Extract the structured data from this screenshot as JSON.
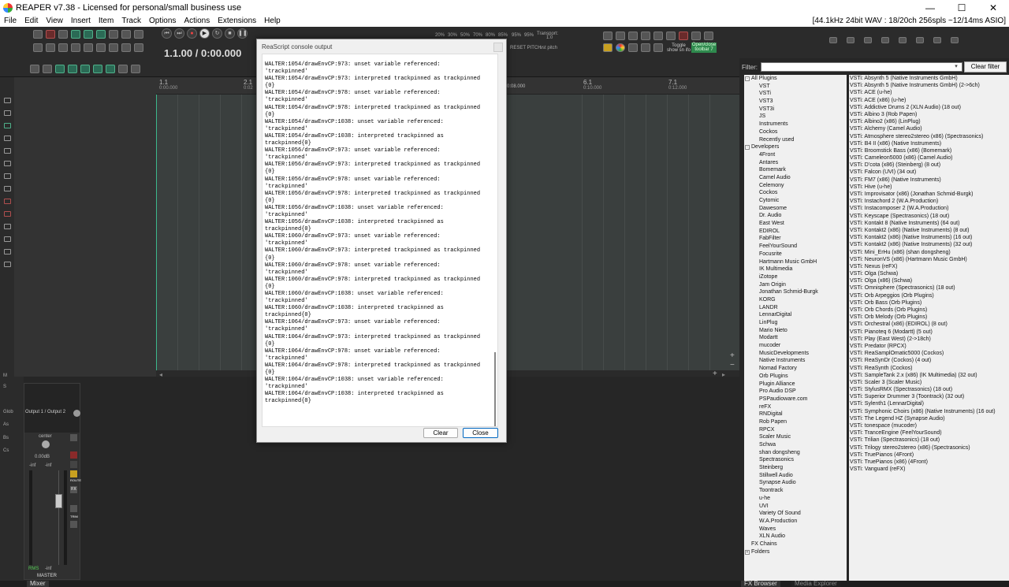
{
  "window": {
    "title": "REAPER v7.38 - Licensed for personal/small business use",
    "min": "—",
    "max": "☐",
    "close": "✕"
  },
  "menu": {
    "items": [
      "File",
      "Edit",
      "View",
      "Insert",
      "Item",
      "Track",
      "Options",
      "Actions",
      "Extensions",
      "Help"
    ],
    "status": "[44.1kHz 24bit WAV : 18/20ch 256spls ~12/14ms ASIO]"
  },
  "transport": {
    "timecode": "1.1.00 / 0:00.000",
    "playrate_ticks": [
      "20%",
      "30%",
      "50%",
      "70%",
      "80%",
      "85%",
      "95%",
      "95%"
    ],
    "playrate_label": "Transport:",
    "playrate_value": "1.0",
    "reset": "RESET PITCH",
    "vst": "vst pitch",
    "toggle": "Toggle show sn ifo",
    "openclose": "Open/close toolbar 7"
  },
  "ruler": {
    "marks": [
      {
        "bar": "1.1",
        "time": "0:00.000"
      },
      {
        "bar": "2.1",
        "time": "0:02"
      },
      {
        "bar": "6.1",
        "time": "0:10.000"
      },
      {
        "bar": "7.1",
        "time": "0:12.000"
      }
    ],
    "hidden_time": "0:08.000"
  },
  "leftbar": {
    "labels": [
      "M",
      "S",
      "Glob",
      "As",
      "Bs",
      "Cs"
    ]
  },
  "mixer": {
    "route": "Output 1 / Output 2",
    "pan": "center",
    "volume": "0.00dB",
    "peak_l": "-inf",
    "peak_r": "-inf",
    "rms": "RMS",
    "rms_val": "-inf",
    "name": "MASTER",
    "route_btn": "ROUTE",
    "fx_btn": "FX",
    "trim_btn": "TRIM"
  },
  "tabs": {
    "mixer": "Mixer",
    "fx_browser": "FX Browser",
    "media_explorer": "Media Explorer"
  },
  "fx": {
    "filter_label": "Filter:",
    "clear_filter": "Clear filter",
    "tree": [
      {
        "label": "All Plugins",
        "level": 0,
        "exp": "-"
      },
      {
        "label": "VST",
        "level": 1
      },
      {
        "label": "VSTi",
        "level": 1
      },
      {
        "label": "VST3",
        "level": 1
      },
      {
        "label": "VST3i",
        "level": 1
      },
      {
        "label": "JS",
        "level": 1
      },
      {
        "label": "Instruments",
        "level": 1
      },
      {
        "label": "Cockos",
        "level": 1
      },
      {
        "label": "Recently used",
        "level": 1
      },
      {
        "label": "Developers",
        "level": 0,
        "exp": "-"
      },
      {
        "label": "4Front",
        "level": 1
      },
      {
        "label": "Antares",
        "level": 1
      },
      {
        "label": "Bomemark",
        "level": 1
      },
      {
        "label": "Camel Audio",
        "level": 1
      },
      {
        "label": "Celemony",
        "level": 1
      },
      {
        "label": "Cockos",
        "level": 1
      },
      {
        "label": "Cytomic",
        "level": 1
      },
      {
        "label": "Dawesome",
        "level": 1
      },
      {
        "label": "Dr. Audio",
        "level": 1
      },
      {
        "label": "East West",
        "level": 1
      },
      {
        "label": "EDIROL",
        "level": 1
      },
      {
        "label": "FabFilter",
        "level": 1
      },
      {
        "label": "FeelYourSound",
        "level": 1
      },
      {
        "label": "Focusrite",
        "level": 1
      },
      {
        "label": "Hartmann Music GmbH",
        "level": 1
      },
      {
        "label": "IK Multimedia",
        "level": 1
      },
      {
        "label": "iZotope",
        "level": 1
      },
      {
        "label": "Jam Origin",
        "level": 1
      },
      {
        "label": "Jonathan Schmid-Burgk",
        "level": 1
      },
      {
        "label": "KORG",
        "level": 1
      },
      {
        "label": "LANDR",
        "level": 1
      },
      {
        "label": "LennarDigital",
        "level": 1
      },
      {
        "label": "LinPlug",
        "level": 1
      },
      {
        "label": "Mario Nieto",
        "level": 1
      },
      {
        "label": "Modartt",
        "level": 1
      },
      {
        "label": "mucoder",
        "level": 1
      },
      {
        "label": "MusicDevelopments",
        "level": 1
      },
      {
        "label": "Native Instruments",
        "level": 1
      },
      {
        "label": "Nomad Factory",
        "level": 1
      },
      {
        "label": "Orb Plugins",
        "level": 1
      },
      {
        "label": "Plugin Alliance",
        "level": 1
      },
      {
        "label": "Pro Audio DSP",
        "level": 1
      },
      {
        "label": "PSPaudioware.com",
        "level": 1
      },
      {
        "label": "reFX",
        "level": 1
      },
      {
        "label": "RNDigital",
        "level": 1
      },
      {
        "label": "Rob Papen",
        "level": 1
      },
      {
        "label": "RPCX",
        "level": 1
      },
      {
        "label": "Scaler Music",
        "level": 1
      },
      {
        "label": "Schwa",
        "level": 1
      },
      {
        "label": "shan dongsheng",
        "level": 1
      },
      {
        "label": "Spectrasonics",
        "level": 1
      },
      {
        "label": "Steinberg",
        "level": 1
      },
      {
        "label": "Stillwell Audio",
        "level": 1
      },
      {
        "label": "Synapse Audio",
        "level": 1
      },
      {
        "label": "Toontrack",
        "level": 1
      },
      {
        "label": "u-he",
        "level": 1
      },
      {
        "label": "UVI",
        "level": 1
      },
      {
        "label": "Variety Of Sound",
        "level": 1
      },
      {
        "label": "W.A.Production",
        "level": 1
      },
      {
        "label": "Waves",
        "level": 1
      },
      {
        "label": "XLN Audio",
        "level": 1
      },
      {
        "label": "FX Chains",
        "level": 0
      },
      {
        "label": "Folders",
        "level": 0,
        "exp": "+"
      }
    ],
    "plugins": [
      "VSTi: Absynth 5 (Native Instruments GmbH)",
      "VSTi: Absynth 5 (Native Instruments GmbH) (2->6ch)",
      "VSTi: ACE (u-he)",
      "VSTi: ACE (x86) (u-he)",
      "VSTi: Addictive Drums 2 (XLN Audio) (18 out)",
      "VSTi: Albino 3 (Rob Papen)",
      "VSTi: Albino2 (x86) (LinPlug)",
      "VSTi: Alchemy (Camel Audio)",
      "VSTi: Atmosphere stereo2stereo (x86) (Spectrasonics)",
      "VSTi: B4 II (x86) (Native Instruments)",
      "VSTi: Broomstick Bass (x86) (Bomemark)",
      "VSTi: Cameleon5000 (x86) (Camel Audio)",
      "VSTi: D'cota (x86) (Steinberg) (8 out)",
      "VSTi: Falcon (UVI) (34 out)",
      "VSTi: FM7 (x86) (Native Instruments)",
      "VSTi: Hive (u-he)",
      "VSTi: Improvisator (x86) (Jonathan Schmid-Burgk)",
      "VSTi: Instachord 2 (W.A.Production)",
      "VSTi: Instacomposer 2 (W.A.Production)",
      "VSTi: Keyscape (Spectrasonics) (18 out)",
      "VSTi: Kontakt 8 (Native Instruments) (64 out)",
      "VSTi: Kontakt2 (x86) (Native Instruments) (8 out)",
      "VSTi: Kontakt2 (x86) (Native Instruments) (16 out)",
      "VSTi: Kontakt2 (x86) (Native Instruments) (32 out)",
      "VSTi: Mini_ErHu (x86) (shan dongsheng)",
      "VSTi: NeuronVS (x86) (Hartmann Music GmbH)",
      "VSTi: Nexus (reFX)",
      "VSTi: Olga (Schwa)",
      "VSTi: Olga (x86) (Schwa)",
      "VSTi: Omnisphere (Spectrasonics) (18 out)",
      "VSTi: Orb Arpeggios (Orb Plugins)",
      "VSTi: Orb Bass (Orb Plugins)",
      "VSTi: Orb Chords (Orb Plugins)",
      "VSTi: Orb Melody (Orb Plugins)",
      "VSTi: Orchestral (x86) (EDIROL) (8 out)",
      "VSTi: Pianoteq 6 (Modartt) (5 out)",
      "VSTi: Play (East West) (2->18ch)",
      "VSTi: Predator (RPCX)",
      "VSTi: ReaSamplOmatic5000 (Cockos)",
      "VSTi: ReaSynDr (Cockos) (4 out)",
      "VSTi: ReaSynth (Cockos)",
      "VSTi: SampleTank 2.x (x86) (IK Multimedia) (32 out)",
      "VSTi: Scaler 3 (Scaler Music)",
      "VSTi: StylusRMX (Spectrasonics) (18 out)",
      "VSTi: Superior Drummer 3 (Toontrack) (32 out)",
      "VSTi: Sylenth1 (LennarDigital)",
      "VSTi: Symphonic Choirs (x86) (Native Instruments) (16 out)",
      "VSTi: The Legend HZ (Synapse Audio)",
      "VSTi: tonespace (mucoder)",
      "VSTi: TranceEngine (FeelYourSound)",
      "VSTi: Trilian (Spectrasonics) (18 out)",
      "VSTi: Trilogy stereo2stereo (x86) (Spectrasonics)",
      "VSTi: TruePianos (4Front)",
      "VSTi: TruePianos (x86) (4Front)",
      "VSTi: Vanguard (reFX)"
    ]
  },
  "dialog": {
    "title": "ReaScript console output",
    "clear": "Clear",
    "close": "Close",
    "console_text": "WALTER:1054/drawEnvCP:973: unset variable referenced:\n'trackpinned'\nWALTER:1054/drawEnvCP:973: interpreted trackpinned as trackpinned\n{0}\nWALTER:1054/drawEnvCP:978: unset variable referenced:\n'trackpinned'\nWALTER:1054/drawEnvCP:978: interpreted trackpinned as trackpinned\n{0}\nWALTER:1054/drawEnvCP:1038: unset variable referenced:\n'trackpinned'\nWALTER:1054/drawEnvCP:1038: interpreted trackpinned as\ntrackpinned{0}\nWALTER:1056/drawEnvCP:973: unset variable referenced:\n'trackpinned'\nWALTER:1056/drawEnvCP:973: interpreted trackpinned as trackpinned\n{0}\nWALTER:1056/drawEnvCP:978: unset variable referenced:\n'trackpinned'\nWALTER:1056/drawEnvCP:978: interpreted trackpinned as trackpinned\n{0}\nWALTER:1056/drawEnvCP:1038: unset variable referenced:\n'trackpinned'\nWALTER:1056/drawEnvCP:1038: interpreted trackpinned as\ntrackpinned{0}\nWALTER:1060/drawEnvCP:973: unset variable referenced:\n'trackpinned'\nWALTER:1060/drawEnvCP:973: interpreted trackpinned as trackpinned\n{0}\nWALTER:1060/drawEnvCP:978: unset variable referenced:\n'trackpinned'\nWALTER:1060/drawEnvCP:978: interpreted trackpinned as trackpinned\n{0}\nWALTER:1060/drawEnvCP:1038: unset variable referenced:\n'trackpinned'\nWALTER:1060/drawEnvCP:1038: interpreted trackpinned as\ntrackpinned{0}\nWALTER:1064/drawEnvCP:973: unset variable referenced:\n'trackpinned'\nWALTER:1064/drawEnvCP:973: interpreted trackpinned as trackpinned\n{0}\nWALTER:1064/drawEnvCP:978: unset variable referenced:\n'trackpinned'\nWALTER:1064/drawEnvCP:978: interpreted trackpinned as trackpinned\n{0}\nWALTER:1064/drawEnvCP:1038: unset variable referenced:\n'trackpinned'\nWALTER:1064/drawEnvCP:1038: interpreted trackpinned as\ntrackpinned{0}"
  }
}
